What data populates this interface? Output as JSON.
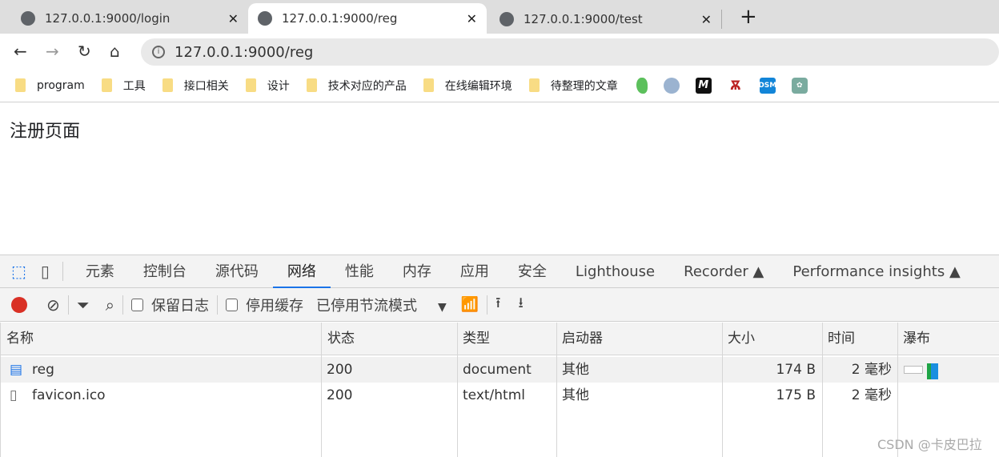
{
  "browser": {
    "tabs": [
      {
        "title": "127.0.0.1:9000/login",
        "active": false
      },
      {
        "title": "127.0.0.1:9000/reg",
        "active": true
      },
      {
        "title": "127.0.0.1:9000/test",
        "active": false
      }
    ],
    "new_tab": "+",
    "close": "✕",
    "address": "127.0.0.1:9000/reg",
    "bookmarks": [
      "program",
      "工具",
      "接口相关",
      "设计",
      "技术对应的产品",
      "在线编辑环境",
      "待整理的文章"
    ],
    "bookmark_icons": [
      "green-leaf-icon",
      "avatar-icon",
      "m-logo-icon",
      "tower-icon",
      "dsm-icon",
      "openai-icon"
    ],
    "dsm": "DSM",
    "m": "M"
  },
  "page": {
    "title": "注册页面"
  },
  "devtools": {
    "tabs": [
      "元素",
      "控制台",
      "源代码",
      "网络",
      "性能",
      "内存",
      "应用",
      "安全",
      "Lighthouse",
      "Recorder",
      "Performance insights"
    ],
    "selected_tab": "网络",
    "toolbar": {
      "preserve_log": "保留日志",
      "disable_cache": "停用缓存",
      "throttling": "已停用节流模式"
    },
    "columns": [
      "名称",
      "状态",
      "类型",
      "启动器",
      "大小",
      "时间",
      "瀑布"
    ],
    "rows": [
      {
        "name": "reg",
        "status": "200",
        "type": "document",
        "initiator": "其他",
        "size": "174 B",
        "time": "2 毫秒"
      },
      {
        "name": "favicon.ico",
        "status": "200",
        "type": "text/html",
        "initiator": "其他",
        "size": "175 B",
        "time": "2 毫秒"
      }
    ],
    "colors": {
      "accent": "#1a73e8",
      "record": "#d93025"
    }
  },
  "watermark": "CSDN @卡皮巴拉"
}
